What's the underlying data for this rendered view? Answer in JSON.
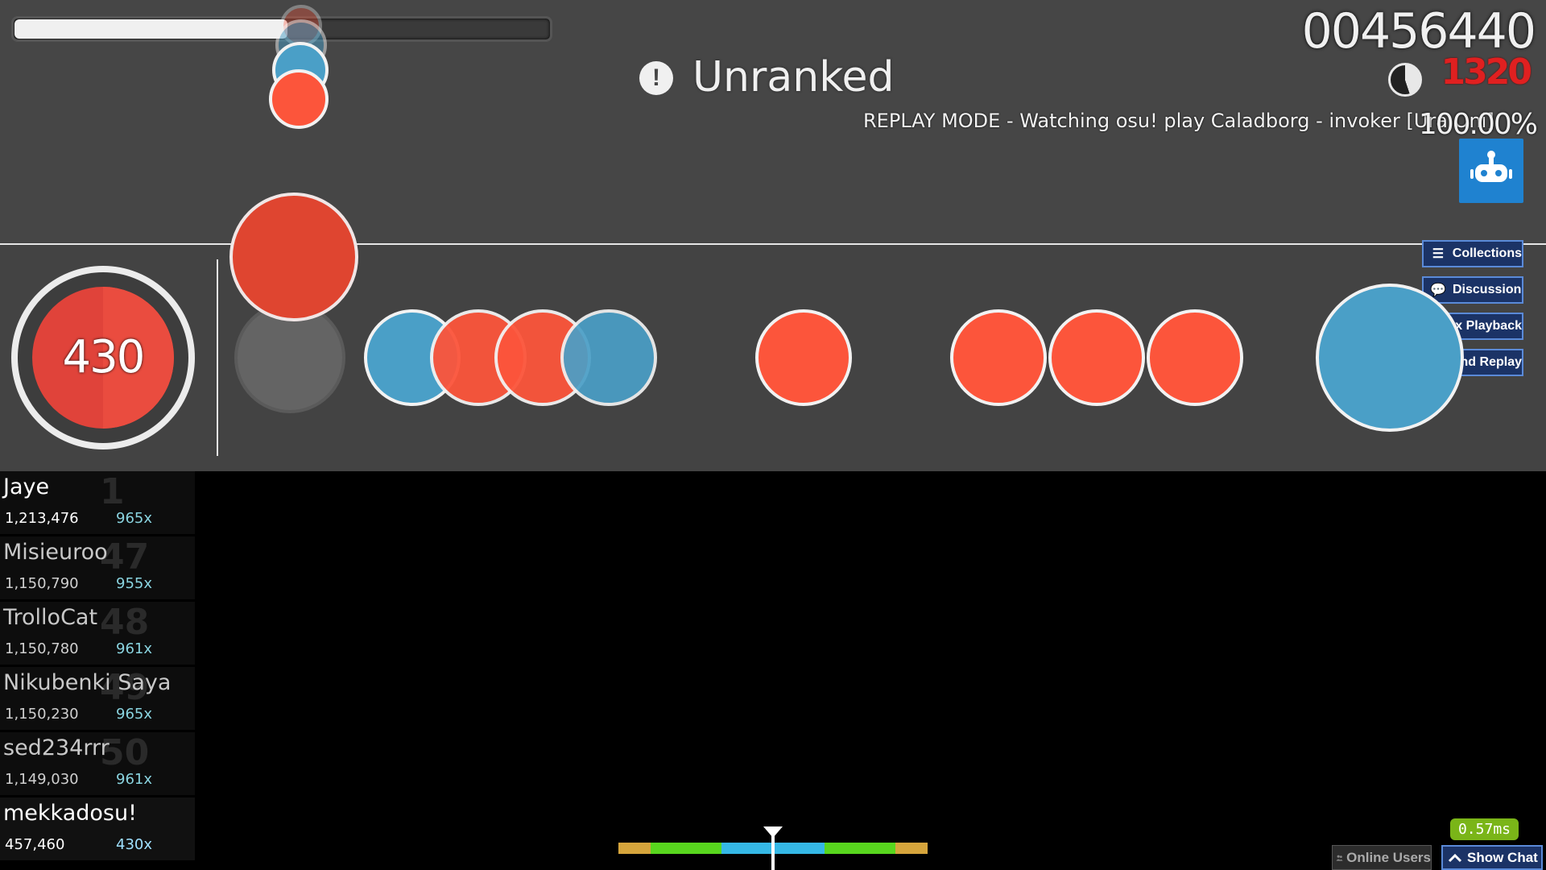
{
  "hud": {
    "score": "00456440",
    "combo_display": "1320",
    "accuracy": "100.00%",
    "health_fraction": 0.51,
    "song_progress_fraction": 0.45,
    "unranked_icon": "!",
    "unranked_label": "Unranked",
    "replay_banner": "REPLAY MODE - Watching osu! play Caladborg - invoker [Ura Oni]",
    "auto_icon": "robot-icon"
  },
  "drum": {
    "combo": "430"
  },
  "side_buttons": [
    {
      "icon": "☰",
      "label": "Collections"
    },
    {
      "icon": "💬",
      "label": "Discussion"
    },
    {
      "icon": "▶",
      "label": "1x Playback"
    },
    {
      "icon": "✖",
      "label": "End Replay"
    }
  ],
  "leaderboard": [
    {
      "name": "Jaye",
      "rank": "1",
      "score": "1,213,476",
      "combo": "965x"
    },
    {
      "name": "Misieuroo",
      "rank": "47",
      "score": "1,150,790",
      "combo": "955x"
    },
    {
      "name": "TrolloCat",
      "rank": "48",
      "score": "1,150,780",
      "combo": "961x"
    },
    {
      "name": "Nikubenki Saya",
      "rank": "49",
      "score": "1,150,230",
      "combo": "965x"
    },
    {
      "name": "sed234rrr",
      "rank": "50",
      "score": "1,149,030",
      "combo": "961x"
    },
    {
      "name": "mekkadosu!",
      "rank": "",
      "score": "457,460",
      "combo": "430x"
    }
  ],
  "footer": {
    "latency": "0.57ms",
    "online_users": "Online Users",
    "show_chat": "Show Chat"
  },
  "colors": {
    "don_red": "#fc553b",
    "kat_blue": "#4a9fc7",
    "button_blue": "#1b3366",
    "latency_green": "#7ab518"
  }
}
